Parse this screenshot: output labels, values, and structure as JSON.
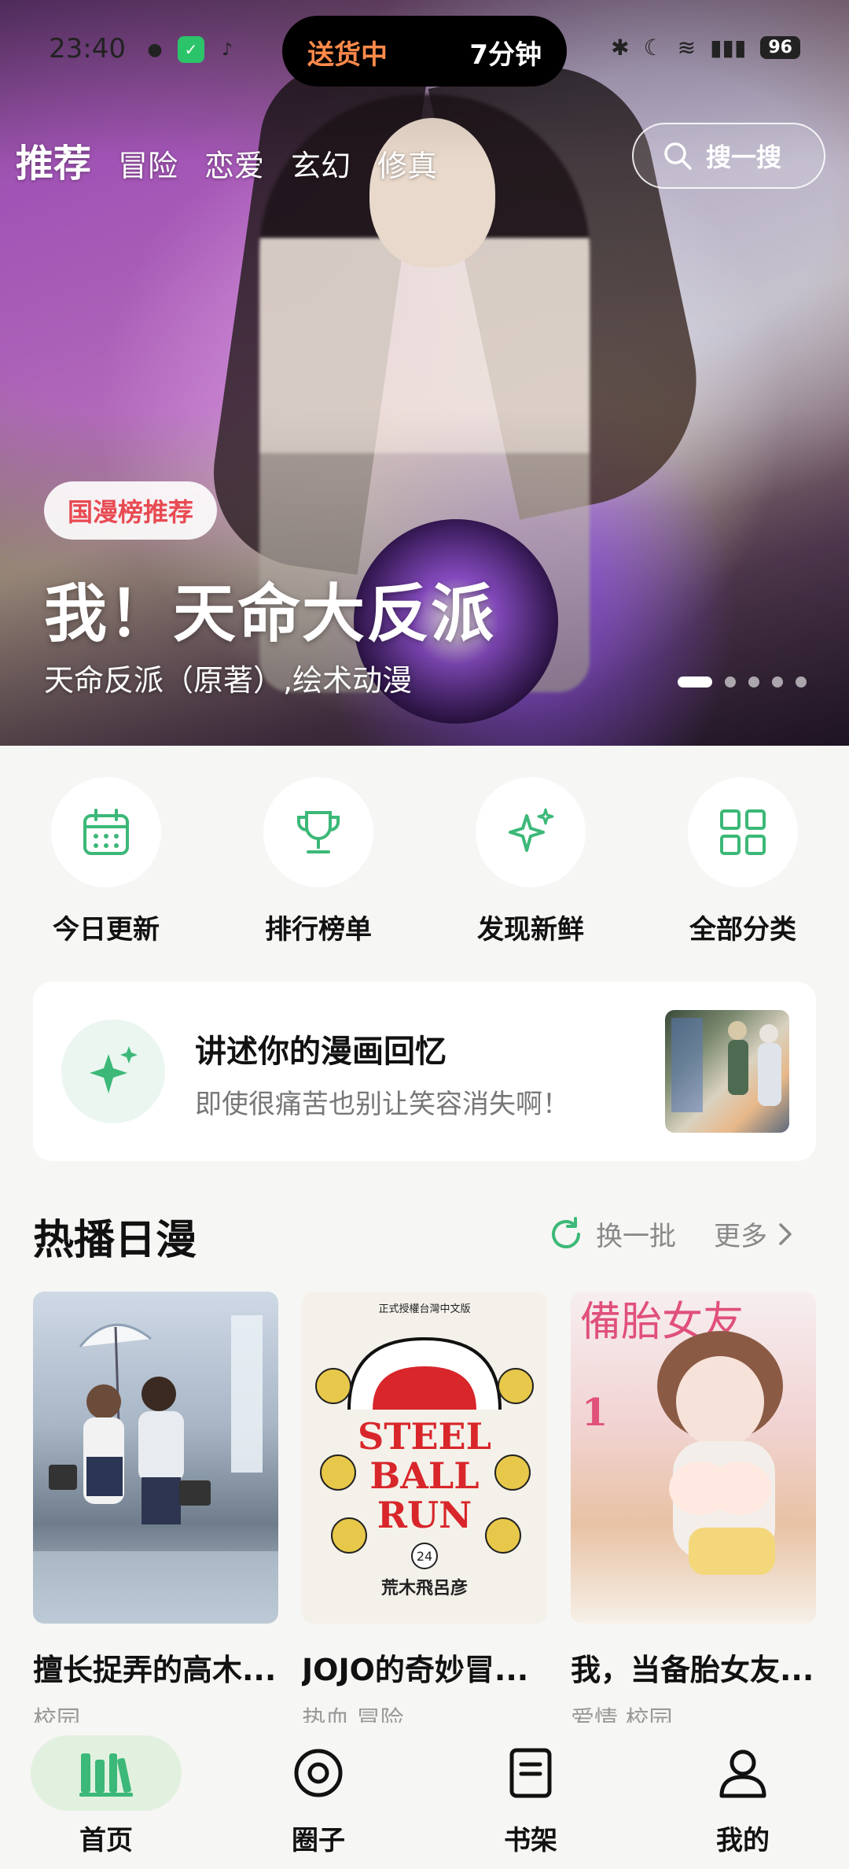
{
  "status_bar": {
    "time": "23:40",
    "island_left": "送货中",
    "island_right": "7分钟",
    "battery": "96"
  },
  "top_nav": {
    "tabs": [
      "推荐",
      "冒险",
      "恋爱",
      "玄幻",
      "修真"
    ],
    "active_tab": "推荐",
    "search_label": "搜一搜"
  },
  "hero": {
    "tag": "国漫榜推荐",
    "title": "我！天命大反派",
    "subtitle": "天命反派（原著）,绘术动漫",
    "page_count": 5,
    "active_page": 1
  },
  "quick_entries": [
    {
      "label": "今日更新",
      "icon": "calendar-icon"
    },
    {
      "label": "排行榜单",
      "icon": "trophy-icon"
    },
    {
      "label": "发现新鲜",
      "icon": "sparkles-icon"
    },
    {
      "label": "全部分类",
      "icon": "grid-icon"
    }
  ],
  "memory_card": {
    "title": "讲述你的漫画回忆",
    "subtitle": "即使很痛苦也别让笑容消失啊！"
  },
  "section": {
    "title": "热播日漫",
    "refresh_label": "换一批",
    "more_label": "更多"
  },
  "books": [
    {
      "name": "擅长捉弄的高木...",
      "tags": "校园"
    },
    {
      "name": "JOJO的奇妙冒...",
      "tags": "热血 冒险"
    },
    {
      "name": "我，当备胎女友...",
      "tags": "爱情 校园"
    }
  ],
  "covers": {
    "c2_top": "正式授權台灣中文版",
    "c2_title_1": "STEEL",
    "c2_title_2": "BALL",
    "c2_title_3": "RUN",
    "c2_volume": "24",
    "c2_author": "荒木飛呂彦",
    "c3_title": "備胎女友",
    "c3_number": "1"
  },
  "tab_bar": [
    {
      "label": "首页",
      "icon": "home-books-icon"
    },
    {
      "label": "圈子",
      "icon": "circle-target-icon"
    },
    {
      "label": "书架",
      "icon": "bookshelf-icon"
    },
    {
      "label": "我的",
      "icon": "profile-icon"
    }
  ],
  "colors": {
    "accent_green": "#3cb878",
    "tag_red": "#e84a52",
    "island_orange": "#ff8a4a"
  }
}
